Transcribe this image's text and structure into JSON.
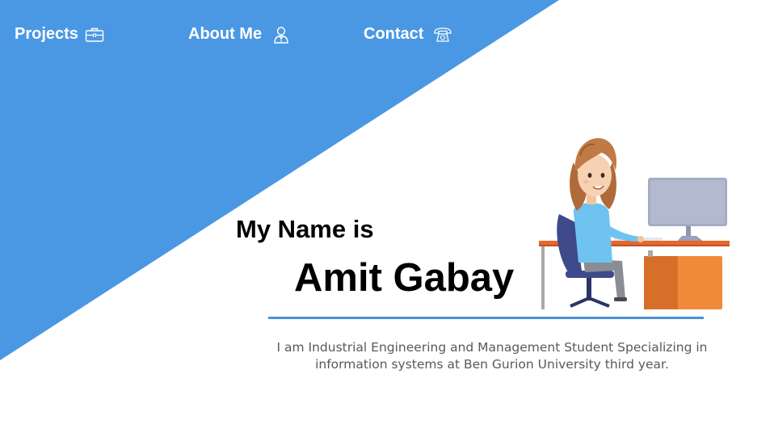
{
  "nav": {
    "items": [
      {
        "label": "Projects",
        "icon": "briefcase-icon"
      },
      {
        "label": "About Me",
        "icon": "person-icon"
      },
      {
        "label": "Contact",
        "icon": "telephone-icon"
      }
    ]
  },
  "hero": {
    "intro": "My Name is",
    "name": "Amit Gabay",
    "bio": "I am Industrial Engineering and Management Student Specializing in information systems at Ben Gurion University third year."
  },
  "colors": {
    "accent": "#4a98e4",
    "divider": "#4a90d9",
    "text_dark": "#000000",
    "text_muted": "#595959"
  }
}
